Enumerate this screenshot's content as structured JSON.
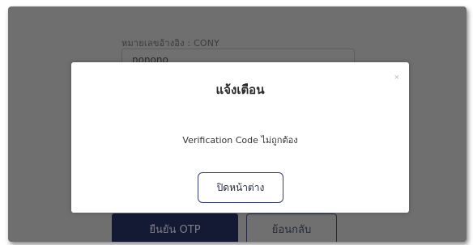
{
  "form": {
    "ref_label": "หมายเลขอ้างอิง : CONY",
    "ref_value": "nonono",
    "confirm_button": "ยืนยัน OTP",
    "back_button": "ย้อนกลับ"
  },
  "modal": {
    "title": "แจ้งเตือน",
    "close_icon": "×",
    "message": "Verification Code ไม่ถูกต้อง",
    "close_button": "ปิดหน้าต่าง"
  },
  "colors": {
    "overlay_page": "#6f6f6f",
    "primary_dark": "#141a33",
    "modal_bg": "#ffffff"
  }
}
